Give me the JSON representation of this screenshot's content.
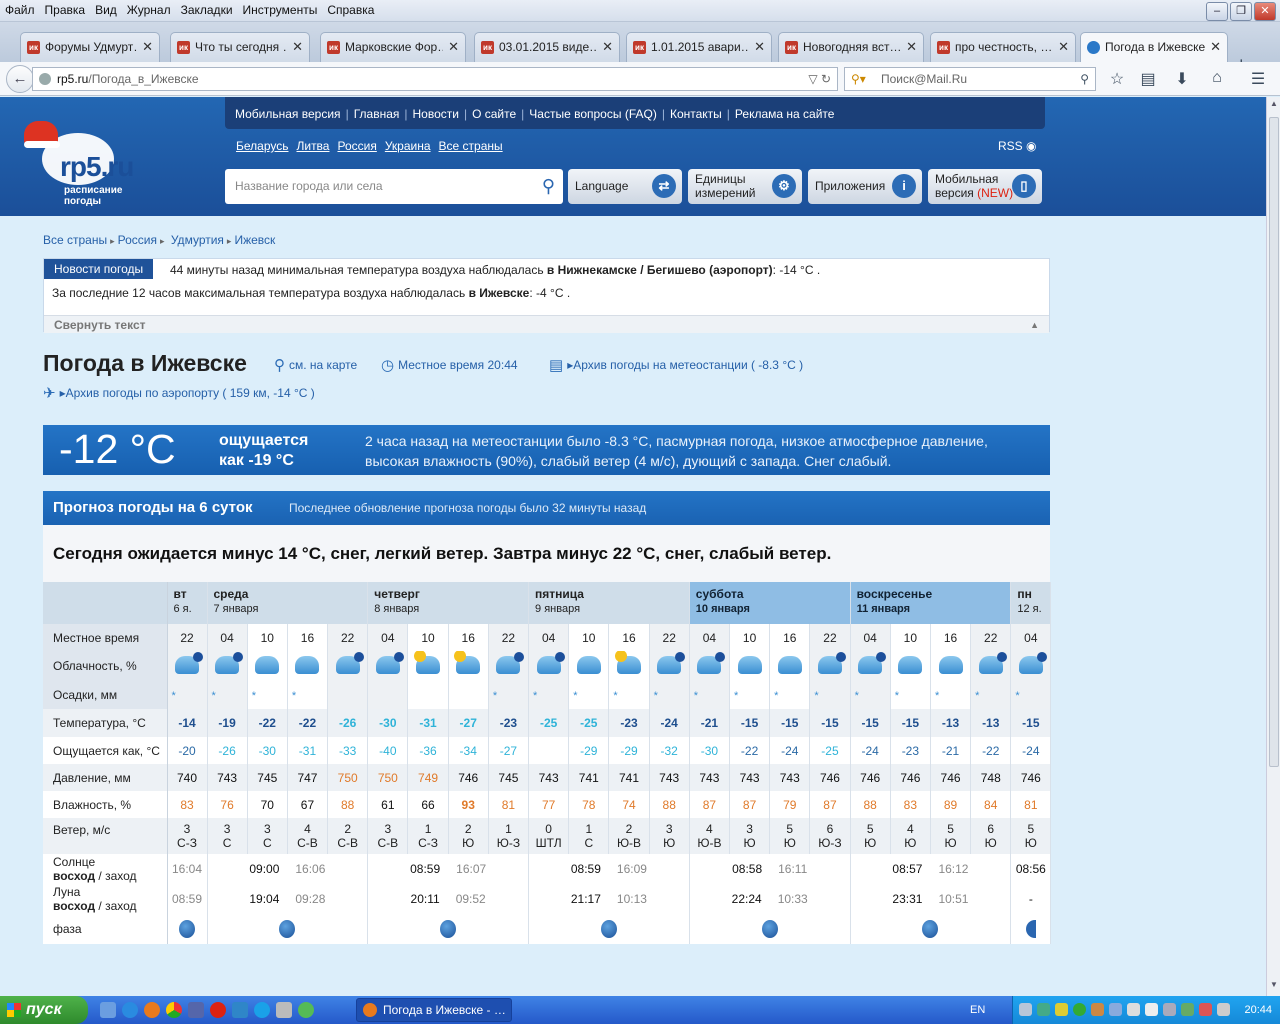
{
  "menu": [
    "Файл",
    "Правка",
    "Вид",
    "Журнал",
    "Закладки",
    "Инструменты",
    "Справка"
  ],
  "tabs": [
    {
      "label": "Форумы Удмурт…",
      "fav": "ик"
    },
    {
      "label": "Что ты сегодня …",
      "fav": "ик"
    },
    {
      "label": "Марковские Фор…",
      "fav": "ик"
    },
    {
      "label": "03.01.2015 виде…",
      "fav": "ик"
    },
    {
      "label": "1.01.2015 авари…",
      "fav": "ик"
    },
    {
      "label": "Новогодняя вст…",
      "fav": "ик"
    },
    {
      "label": "про честность, …",
      "fav": "ик"
    },
    {
      "label": "Погода в Ижевске",
      "fav": ""
    }
  ],
  "address": {
    "host": "rp5.ru",
    "path": "/Погода_в_Ижевске"
  },
  "search": {
    "placeholder": "Поиск@Mail.Ru"
  },
  "site": {
    "logo": "rp5.ru",
    "logo_sub": "расписание погоды",
    "topnav": [
      "Мобильная версия",
      "Главная",
      "Новости",
      "О сайте",
      "Частые вопросы (FAQ)",
      "Контакты",
      "Реклама на сайте"
    ],
    "countries": [
      "Беларусь",
      "Литва",
      "Россия",
      "Украина",
      "Все страны"
    ],
    "rss": "RSS",
    "city_placeholder": "Название города или села",
    "btn_language": "Language",
    "btn_units": "Единицы\nизмерений",
    "btn_apps": "Приложения",
    "btn_mobile": "Мобильная",
    "btn_mobile2": "версия",
    "btn_new": "(NEW)"
  },
  "crumbs": [
    "Все страны",
    "Россия",
    "Удмуртия",
    "Ижевск"
  ],
  "news": {
    "tag": "Новости погоды",
    "l1a": "44 минуты назад минимальная температура воздуха наблюдалась ",
    "l1b": "в Нижнекамске / Бегишево (аэропорт)",
    "l1c": ": -14 °С .",
    "l2a": "За последние 12 часов максимальная температура воздуха наблюдалась ",
    "l2b": "в Ижевске",
    "l2c": ": -4 °С .",
    "fold": "Свернуть текст"
  },
  "title": "Погода в Ижевске",
  "links": {
    "map": "см. на карте",
    "localtime": "Местное время  20:44",
    "archive": "Архив погоды на метеостанции ( -8.3 °С )",
    "airport": "Архив погоды по аэропорту ( 159 км, -14 °С )"
  },
  "current": {
    "temp": "-12 °С",
    "feels1": "ощущается",
    "feels2": "как -19 °С",
    "desc": "2 часа назад на метеостанции было -8.3 °С, пасмурная погода, низкое атмосферное давление, высокая влажность (90%), слабый ветер (4 м/с), дующий с запада. Снег слабый."
  },
  "forecast": {
    "head": "Прогноз погоды на 6 суток",
    "updated": "Последнее обновление прогноза погоды было 32 минуты назад",
    "summary": "Сегодня ожидается минус 14 °С, снег, легкий ветер. Завтра минус 22 °С, снег, слабый ветер."
  },
  "table": {
    "labels": {
      "time": "Местное время",
      "cloud": "Облачность, %",
      "precip": "Осадки, мм",
      "temp": "Температура, °С",
      "feels": "Ощущается как, °С",
      "press": "Давление, мм",
      "hum": "Влажность, %",
      "wind": "Ветер, м/с",
      "sun1": "Солнце",
      "sun2": "восход",
      "sun3": "заход",
      "moon1": "Луна",
      "moon2": "восход",
      "moon3": "заход",
      "phase": "фаза"
    },
    "days": [
      {
        "name": "вт",
        "date": "6 я.",
        "span": 1,
        "wk": false
      },
      {
        "name": "среда",
        "date": "7 января",
        "span": 4,
        "wk": false
      },
      {
        "name": "четверг",
        "date": "8 января",
        "span": 4,
        "wk": false
      },
      {
        "name": "пятница",
        "date": "9 января",
        "span": 4,
        "wk": false
      },
      {
        "name": "суббота",
        "date": "10 января",
        "span": 4,
        "wk": true
      },
      {
        "name": "воскресенье",
        "date": "11 января",
        "span": 4,
        "wk": true
      },
      {
        "name": "пн",
        "date": "12 я.",
        "span": 1,
        "wk": false
      }
    ],
    "times": [
      "22",
      "04",
      "10",
      "16",
      "22",
      "04",
      "10",
      "16",
      "22",
      "04",
      "10",
      "16",
      "22",
      "04",
      "10",
      "16",
      "22",
      "04",
      "10",
      "16",
      "22",
      "04"
    ],
    "clouds": [
      "n",
      "n",
      "",
      "",
      "n",
      "n",
      "s",
      "s",
      "n",
      "n",
      "",
      "s",
      "n",
      "n",
      "",
      "",
      "n",
      "n",
      "",
      "",
      "n",
      "n"
    ],
    "precip": [
      "*",
      "*",
      "*",
      "*",
      "",
      "",
      "",
      "",
      "*",
      "*",
      "*",
      "*",
      "*",
      "*",
      "*",
      "*",
      "*",
      "*",
      "*",
      "*",
      "*",
      "*"
    ],
    "temps": [
      "-14",
      "-19",
      "-22",
      "-22",
      "-26",
      "-30",
      "-31",
      "-27",
      "-23",
      "-25",
      "-25",
      "-23",
      "-24",
      "-21",
      "-15",
      "-15",
      "-15",
      "-15",
      "-15",
      "-13",
      "-13",
      "-15"
    ],
    "feels": [
      "-20",
      "-26",
      "-30",
      "-31",
      "-33",
      "-40",
      "-36",
      "-34",
      "-27",
      "",
      "-29",
      "-29",
      "-32",
      "-30",
      "-22",
      "-24",
      "-25",
      "-24",
      "-23",
      "-21",
      "-22",
      "-24"
    ],
    "press": [
      "740",
      "743",
      "745",
      "747",
      "750",
      "750",
      "749",
      "746",
      "745",
      "743",
      "741",
      "741",
      "743",
      "743",
      "743",
      "743",
      "746",
      "746",
      "746",
      "746",
      "748",
      "746"
    ],
    "hum": [
      "83",
      "76",
      "70",
      "67",
      "88",
      "61",
      "66",
      "93",
      "81",
      "77",
      "78",
      "74",
      "88",
      "87",
      "87",
      "79",
      "87",
      "88",
      "83",
      "89",
      "84",
      "81"
    ],
    "wind": [
      "3",
      "3",
      "3",
      "4",
      "2",
      "3",
      "1",
      "2",
      "1",
      "0",
      "1",
      "2",
      "3",
      "4",
      "3",
      "5",
      "6",
      "5",
      "4",
      "5",
      "6",
      "5"
    ],
    "wdir": [
      "С-З",
      "С",
      "С",
      "С-В",
      "С-В",
      "С-В",
      "С-З",
      "Ю",
      "Ю-З",
      "ШТЛ",
      "С",
      "Ю-В",
      "Ю",
      "Ю-В",
      "Ю",
      "Ю",
      "Ю-З",
      "Ю",
      "Ю",
      "Ю",
      "Ю",
      "Ю"
    ],
    "sun_rise": [
      "",
      "09:00",
      "08:59",
      "08:59",
      "08:58",
      "08:57",
      "08:56"
    ],
    "sun_set": [
      "16:04",
      "16:06",
      "16:07",
      "16:09",
      "16:11",
      "16:12",
      ""
    ],
    "moon_rise": [
      "",
      "19:04",
      "20:11",
      "21:17",
      "22:24",
      "23:31",
      "-"
    ],
    "moon_set": [
      "08:59",
      "09:28",
      "09:52",
      "10:13",
      "10:33",
      "10:51",
      ""
    ]
  },
  "taskbar": {
    "start": "пуск",
    "task": "Погода в Ижевске - …",
    "lang": "EN",
    "clock": "20:44"
  }
}
